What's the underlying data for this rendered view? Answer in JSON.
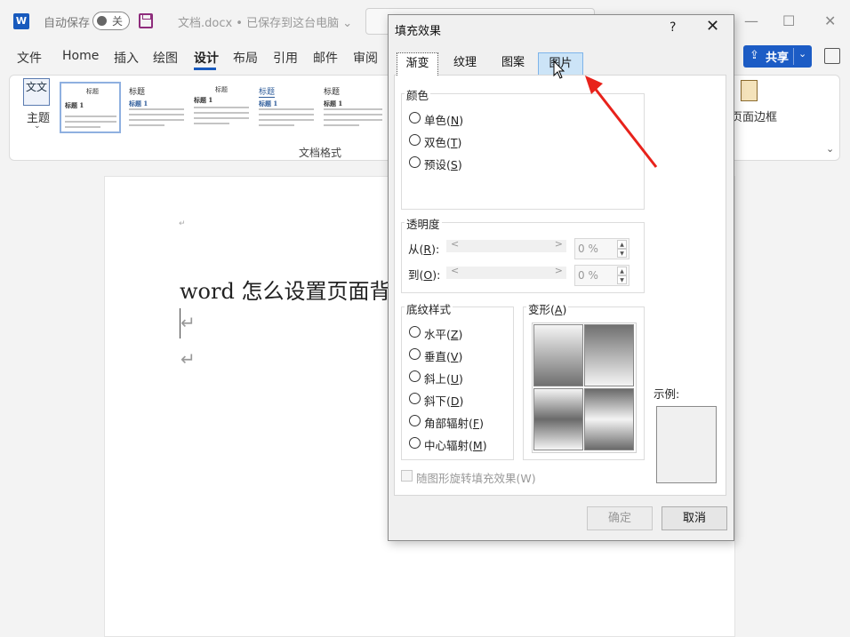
{
  "titlebar": {
    "app_icon": "W",
    "autosave_label": "自动保存",
    "autosave_state": "关",
    "doc_title": "文档.docx • 已保存到这台电脑 ⌄",
    "minimize": "—",
    "maximize": "☐",
    "close": "✕"
  },
  "tabs": [
    "文件",
    "Home",
    "插入",
    "绘图",
    "设计",
    "布局",
    "引用",
    "邮件",
    "审阅"
  ],
  "share": {
    "icon": "⇪",
    "label": "共享",
    "caret": "⌄"
  },
  "ribbon": {
    "theme_icon": "文文",
    "theme_label": "主题",
    "theme_caret": "⌄",
    "group_label": "文档格式",
    "page_border_label": "页面边框",
    "collapse": "⌄",
    "styles": [
      {
        "heading": "标题",
        "title1": "标题 1"
      },
      {
        "heading": "标题",
        "title1": "标题 1"
      },
      {
        "heading": "标题",
        "title1": "标题 1"
      },
      {
        "heading": "标题",
        "title1": "标题 1"
      },
      {
        "heading": "标题",
        "title1": "标题 1"
      }
    ]
  },
  "document": {
    "para_mark": "↵",
    "heading": "word 怎么设置页面背",
    "enter": "↵"
  },
  "dialog": {
    "title": "填充效果",
    "help": "?",
    "close": "✕",
    "tabs": [
      "渐变",
      "纹理",
      "图案",
      "图片"
    ],
    "active_tab": "渐变",
    "hovered_tab": "图片",
    "color_group": {
      "label": "颜色",
      "options": [
        {
          "label": "单色(",
          "key": "N",
          "end": ")"
        },
        {
          "label": "双色(",
          "key": "T",
          "end": ")"
        },
        {
          "label": "预设(",
          "key": "S",
          "end": ")"
        }
      ]
    },
    "transparency": {
      "label": "透明度",
      "from": {
        "label": "从(",
        "key": "R",
        "end": "):",
        "value": "0 %"
      },
      "to": {
        "label": "到(",
        "key": "O",
        "end": "):",
        "value": "0 %"
      }
    },
    "shading": {
      "label": "底纹样式",
      "options": [
        {
          "label": "水平(",
          "key": "Z",
          "end": ")"
        },
        {
          "label": "垂直(",
          "key": "V",
          "end": ")"
        },
        {
          "label": "斜上(",
          "key": "U",
          "end": ")"
        },
        {
          "label": "斜下(",
          "key": "D",
          "end": ")"
        },
        {
          "label": "角部辐射(",
          "key": "F",
          "end": ")"
        },
        {
          "label": "中心辐射(",
          "key": "M",
          "end": ")"
        }
      ]
    },
    "variants": {
      "label": "变形(",
      "key": "A",
      "end": ")"
    },
    "sample_label": "示例:",
    "rotate_label": "随图形旋转填充效果(W)",
    "ok": "确定",
    "cancel": "取消"
  },
  "annotation": {
    "arrow_color": "#e8221b"
  },
  "colors": {
    "accent": "#185abd",
    "share": "#1c5cc5"
  }
}
